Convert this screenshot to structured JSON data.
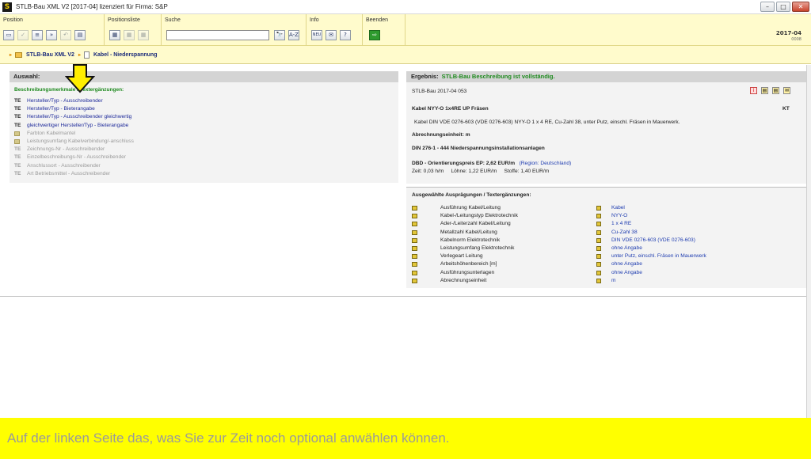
{
  "window": {
    "title": "STLB-Bau XML V2 [2017-04] lizenziert für Firma: S&P",
    "logo": "S"
  },
  "toolbar": {
    "groups": [
      {
        "label": "Position",
        "icons": [
          "new-doc-icon",
          "check-icon",
          "list-icon",
          "forward-icon",
          "undo-icon",
          "page-icon"
        ]
      },
      {
        "label": "Positionsliste",
        "icons": [
          "list-add-icon",
          "list-copy-icon",
          "list-edit-icon"
        ]
      },
      {
        "label": "Suche",
        "search_value": "",
        "find_label": "🔭",
        "az_label": "A-Z"
      },
      {
        "label": "Info",
        "new_label": "NEU",
        "mail_label": "✉",
        "help_label": "?"
      },
      {
        "label": "Beenden",
        "exit_label": "⇨"
      }
    ],
    "version": "2017-04",
    "version_sub": "0008"
  },
  "breadcrumb": {
    "root": "STLB-Bau XML V2",
    "current": "Kabel - Niederspannung"
  },
  "left": {
    "header": "Auswahl:",
    "subheader": "Beschreibungsmerkmale / Textergänzungen:",
    "items": [
      {
        "tag": "TE",
        "text": "Hersteller/Typ - Ausschreibender",
        "active": true
      },
      {
        "tag": "TE",
        "text": "Hersteller/Typ - Bieterangabe",
        "active": true
      },
      {
        "tag": "TE",
        "text": "Hersteller/Typ - Ausschreibender gleichwertig",
        "active": true
      },
      {
        "tag": "TE",
        "text": "gleichwertiger Hersteller/Typ - Bieterangabe",
        "active": true
      },
      {
        "tag": "",
        "text": "Farbton Kabelmantel",
        "active": false
      },
      {
        "tag": "",
        "text": "Leistungsumfang Kabelverbindung/-anschluss",
        "active": false
      },
      {
        "tag": "TE",
        "text": "Zeichnungs-Nr - Ausschreibender",
        "active": false
      },
      {
        "tag": "TE",
        "text": "Einzelbeschreibungs-Nr - Ausschreibender",
        "active": false
      },
      {
        "tag": "TE",
        "text": "Anschlussort - Ausschreibender",
        "active": false
      },
      {
        "tag": "TE",
        "text": "Art Betriebsmittel - Ausschreibender",
        "active": false
      }
    ]
  },
  "result": {
    "header_label": "Ergebnis:",
    "header_status": "STLB-Bau Beschreibung ist vollständig.",
    "source": "STLB-Bau 2017-04 053",
    "short_text": "Kabel NYY-O 1x4RE UP Fräsen",
    "unit_code": "KT",
    "long_text": "Kabel DIN VDE 0276-603 (VDE 0276-603) NYY-O 1 x 4 RE, Cu-Zahl 38, unter Putz, einschl. Fräsen in Mauerwerk.",
    "unit": "Abrechnungseinheit: m",
    "din": "DIN 276-1 - 444 Niederspannungsinstallationsanlagen",
    "price": "DBD - Orientierungspreis EP: 2,62 EUR/m",
    "region": "(Region: Deutschland)",
    "costs": "Zeit: 0,03 h/m     Löhne: 1,22 EUR/m     Stoffe: 1,40 EUR/m"
  },
  "selections": {
    "header": "Ausgewählte Ausprägungen / Textergänzungen:",
    "rows": [
      {
        "label": "Ausführung Kabel/Leitung",
        "value": "Kabel"
      },
      {
        "label": "Kabel-/Leitungstyp Elektrotechnik",
        "value": "NYY-O"
      },
      {
        "label": "Ader-/Leiterzahl Kabel/Leitung",
        "value": "1 x 4 RE"
      },
      {
        "label": "Metallzahl Kabel/Leitung",
        "value": "Cu-Zahl 38"
      },
      {
        "label": "Kabelnorm Elektrotechnik",
        "value": "DIN VDE 0276-603 (VDE 0276-603)"
      },
      {
        "label": "Leistungsumfang Elektrotechnik",
        "value": "ohne Angabe"
      },
      {
        "label": "Verlegeart Leitung",
        "value": "unter Putz, einschl. Fräsen in Mauerwerk"
      },
      {
        "label": "Arbeitshöhenbereich [m]",
        "value": "ohne Angabe"
      },
      {
        "label": "Ausführungsunterlagen",
        "value": "ohne Angabe"
      },
      {
        "label": "Abrechnungseinheit",
        "value": "m"
      }
    ]
  },
  "caption": "Auf der linken Seite das, was Sie zur Zeit noch optional anwählen können.",
  "colors": {
    "toolbar_bg": "#fffbcc",
    "caption_bg": "#ffff00",
    "accent_green": "#1f8a1f",
    "link_blue": "#1e2a9a"
  }
}
